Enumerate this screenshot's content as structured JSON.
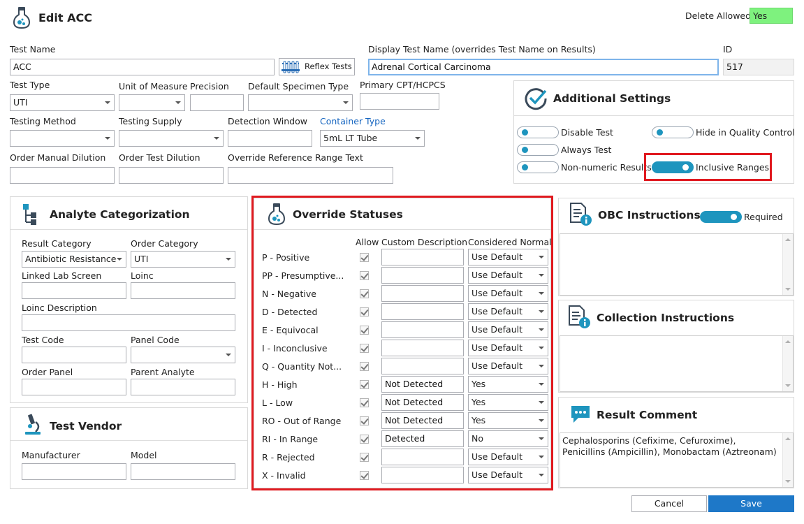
{
  "window": {
    "title": "Edit ACC",
    "delete_allowed_label": "Delete Allowed",
    "delete_allowed_value": "Yes"
  },
  "fields": {
    "test_name": {
      "label": "Test Name",
      "value": "ACC"
    },
    "reflex_tests_label": "Reflex Tests",
    "display_test_name": {
      "label": "Display Test Name (overrides Test Name on Results)",
      "value": "Adrenal Cortical Carcinoma"
    },
    "id": {
      "label": "ID",
      "value": "517"
    },
    "test_type": {
      "label": "Test Type",
      "value": "UTI"
    },
    "unit_of_measure": {
      "label": "Unit of Measure",
      "value": ""
    },
    "precision": {
      "label": "Precision",
      "value": ""
    },
    "default_specimen_type": {
      "label": "Default Specimen Type",
      "value": ""
    },
    "primary_cpt": {
      "label": "Primary CPT/HCPCS",
      "value": ""
    },
    "testing_method": {
      "label": "Testing Method",
      "value": ""
    },
    "testing_supply": {
      "label": "Testing Supply",
      "value": ""
    },
    "detection_window": {
      "label": "Detection Window",
      "value": ""
    },
    "container_type": {
      "label": "Container Type",
      "value": "5mL LT Tube"
    },
    "order_manual_dilution": {
      "label": "Order Manual Dilution",
      "value": ""
    },
    "order_test_dilution": {
      "label": "Order Test Dilution",
      "value": ""
    },
    "override_reference_range_text": {
      "label": "Override Reference Range Text",
      "value": ""
    }
  },
  "additional_settings": {
    "title": "Additional Settings",
    "toggles": {
      "disable_test": {
        "label": "Disable Test",
        "on": false
      },
      "hide_in_qc": {
        "label": "Hide in Quality Control",
        "on": false
      },
      "always_test": {
        "label": "Always Test",
        "on": false
      },
      "non_numeric_results": {
        "label": "Non-numeric Results",
        "on": false
      },
      "inclusive_ranges": {
        "label": "Inclusive Ranges",
        "on": true
      }
    }
  },
  "analyte_categorization": {
    "title": "Analyte Categorization",
    "result_category": {
      "label": "Result Category",
      "value": "Antibiotic Resistance"
    },
    "order_category": {
      "label": "Order Category",
      "value": "UTI"
    },
    "linked_lab_screen": {
      "label": "Linked Lab Screen",
      "value": ""
    },
    "loinc": {
      "label": "Loinc",
      "value": ""
    },
    "loinc_description": {
      "label": "Loinc Description",
      "value": ""
    },
    "test_code": {
      "label": "Test Code",
      "value": ""
    },
    "panel_code": {
      "label": "Panel Code",
      "value": ""
    },
    "order_panel": {
      "label": "Order Panel",
      "value": ""
    },
    "parent_analyte": {
      "label": "Parent Analyte",
      "value": ""
    }
  },
  "test_vendor": {
    "title": "Test Vendor",
    "manufacturer": {
      "label": "Manufacturer",
      "value": ""
    },
    "model": {
      "label": "Model",
      "value": ""
    }
  },
  "override_statuses": {
    "title": "Override Statuses",
    "headers": {
      "allow": "Allow",
      "custom_description": "Custom Description",
      "considered_normal": "Considered Normal"
    },
    "rows": [
      {
        "status": "P - Positive",
        "allow": true,
        "custom": "",
        "normal": "Use Default"
      },
      {
        "status": "PP - Presumptive...",
        "allow": true,
        "custom": "",
        "normal": "Use Default"
      },
      {
        "status": "N - Negative",
        "allow": true,
        "custom": "",
        "normal": "Use Default"
      },
      {
        "status": "D - Detected",
        "allow": true,
        "custom": "",
        "normal": "Use Default"
      },
      {
        "status": "E - Equivocal",
        "allow": true,
        "custom": "",
        "normal": "Use Default"
      },
      {
        "status": "I - Inconclusive",
        "allow": true,
        "custom": "",
        "normal": "Use Default"
      },
      {
        "status": "Q - Quantity Not...",
        "allow": true,
        "custom": "",
        "normal": "Use Default"
      },
      {
        "status": "H - High",
        "allow": true,
        "custom": "Not Detected",
        "normal": "Yes"
      },
      {
        "status": "L - Low",
        "allow": true,
        "custom": "Not Detected",
        "normal": "Yes"
      },
      {
        "status": "RO - Out of Range",
        "allow": true,
        "custom": "Not Detected",
        "normal": "Yes"
      },
      {
        "status": "RI - In Range",
        "allow": true,
        "custom": "Detected",
        "normal": "No"
      },
      {
        "status": "R - Rejected",
        "allow": true,
        "custom": "",
        "normal": "Use Default"
      },
      {
        "status": "X - Invalid",
        "allow": true,
        "custom": "",
        "normal": "Use Default"
      }
    ]
  },
  "obc_instructions": {
    "title": "OBC Instructions",
    "required_label": "Required",
    "required_on": true,
    "text": ""
  },
  "collection_instructions": {
    "title": "Collection Instructions",
    "text": ""
  },
  "result_comment": {
    "title": "Result Comment",
    "text": "Cephalosporins (Cefixime, Cefuroxime), Penicillins (Ampicillin), Monobactam (Aztreonam)"
  },
  "buttons": {
    "cancel": "Cancel",
    "save": "Save"
  },
  "colors": {
    "accent": "#1e95be",
    "save_button": "#1e78c8",
    "highlight": "#e0191f",
    "delete_allowed_bg": "#7ef27e"
  }
}
